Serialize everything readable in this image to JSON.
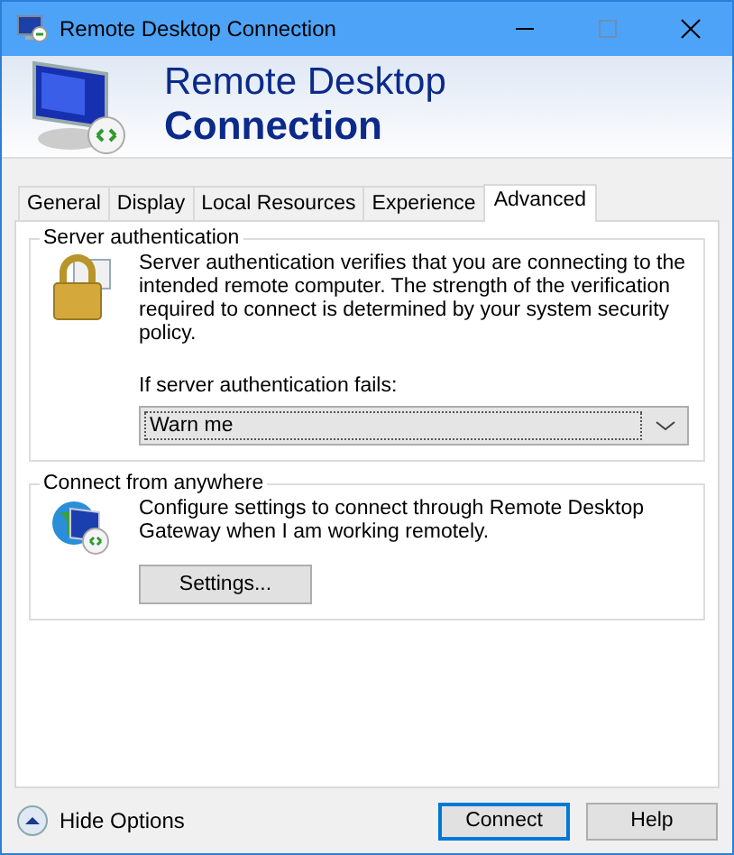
{
  "window": {
    "title": "Remote Desktop Connection"
  },
  "header": {
    "line1": "Remote Desktop",
    "line2": "Connection"
  },
  "tabs": [
    {
      "label": "General",
      "selected": false
    },
    {
      "label": "Display",
      "selected": false
    },
    {
      "label": "Local Resources",
      "selected": false
    },
    {
      "label": "Experience",
      "selected": false
    },
    {
      "label": "Advanced",
      "selected": true
    }
  ],
  "server_authentication": {
    "title": "Server authentication",
    "description": "Server authentication verifies that you are connecting to the intended remote computer. The strength of the verification required to connect is determined by your system security policy.",
    "dropdown_label": "If server authentication fails:",
    "dropdown_value": "Warn me"
  },
  "connect_from_anywhere": {
    "title": "Connect from anywhere",
    "description": "Configure settings to connect through Remote Desktop Gateway when I am working remotely.",
    "button": "Settings..."
  },
  "footer": {
    "toggle": "Hide Options",
    "buttons": [
      {
        "label": "Connect",
        "default": true
      },
      {
        "label": "Help",
        "default": false
      }
    ]
  }
}
